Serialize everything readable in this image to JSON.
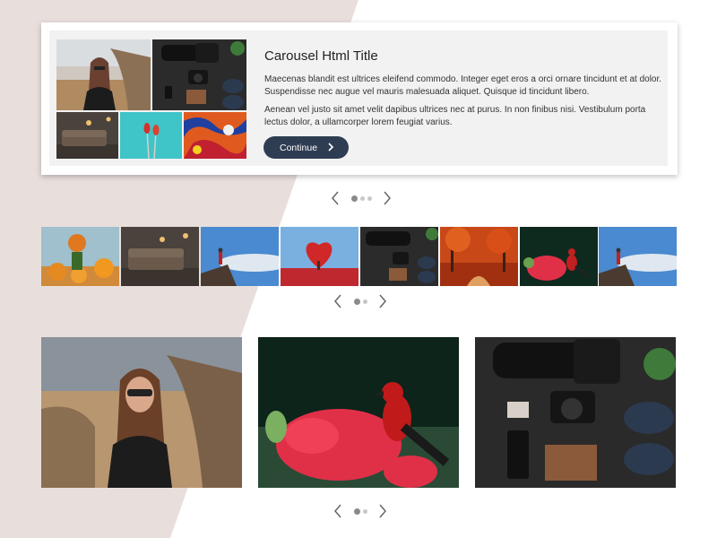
{
  "carousel_card": {
    "title": "Carousel Html Title",
    "paragraph1": "Maecenas blandit est ultrices eleifend commodo. Integer eget eros a orci ornare tincidunt et at dolor. Suspendisse nec augue vel mauris malesuada aliquet. Quisque id tincidunt libero.",
    "paragraph2": "Aenean vel justo sit amet velit dapibus ultrices nec at purus. In non finibus nisi. Vestibulum porta lectus dolor, a ullamcorper lorem feugiat varius.",
    "button_label": "Continue"
  },
  "colors": {
    "accent": "#2f3d52",
    "background_shape": "#e8dfdc",
    "card_panel": "#f2f2f2"
  },
  "strip_items": [
    "pumpkins",
    "living-room",
    "hiker-on-rock",
    "heart-tree",
    "camera-flatlay",
    "autumn-forest",
    "red-bird",
    "hiker-on-rock"
  ],
  "big_items": [
    "woman-portrait",
    "red-bird-flowers",
    "camera-flatlay"
  ],
  "pagination": {
    "top": {
      "count": 3,
      "active": 1
    },
    "strip": {
      "count": 2,
      "active": 1
    },
    "bottom": {
      "count": 2,
      "active": 1
    }
  }
}
